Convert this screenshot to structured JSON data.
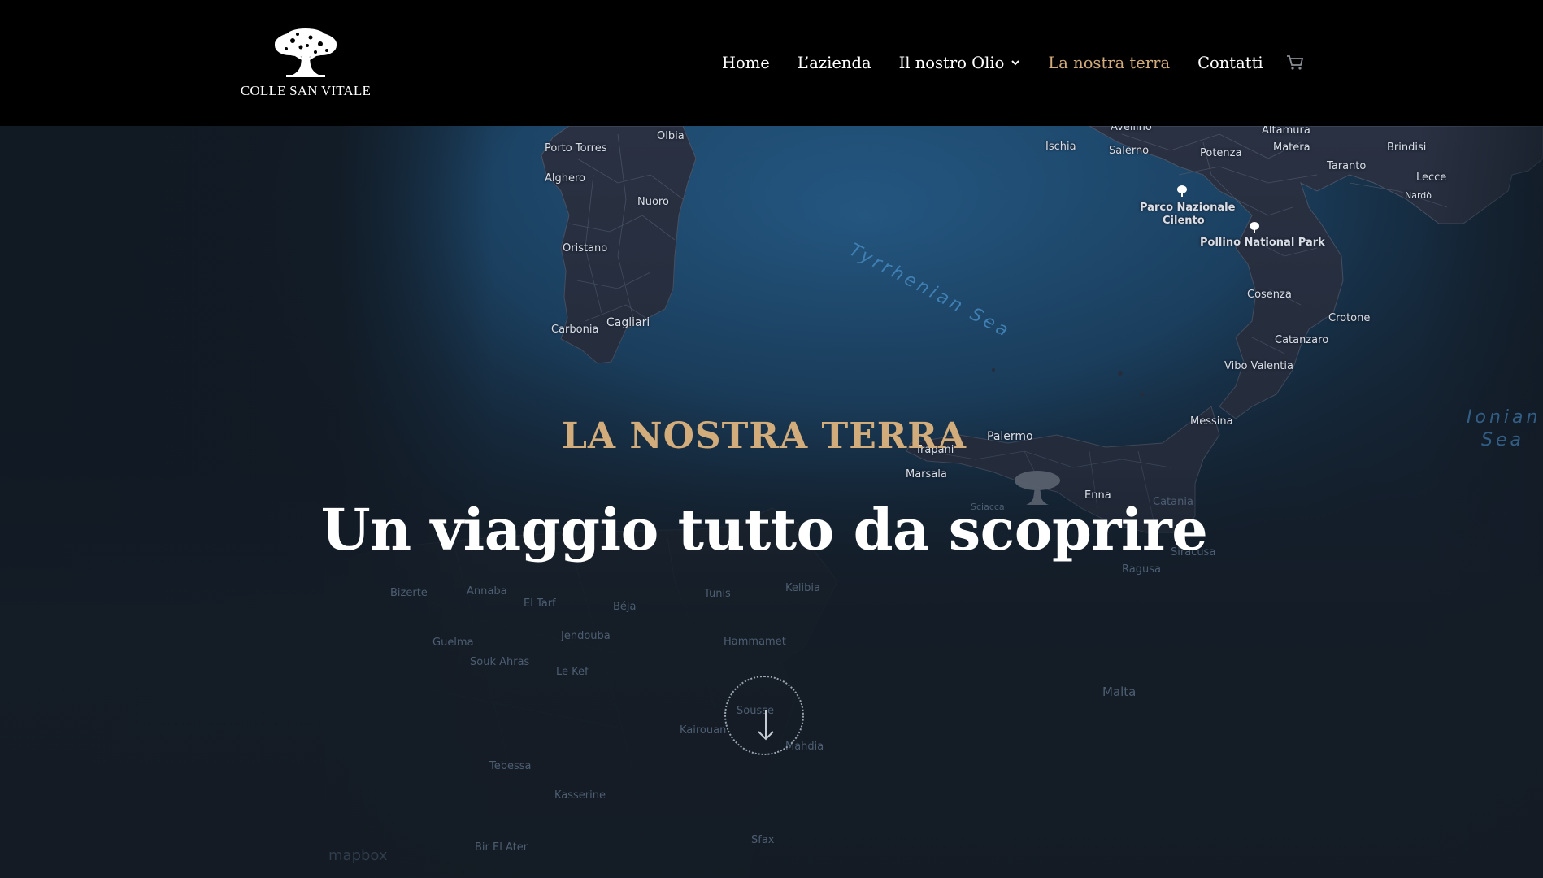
{
  "header": {
    "brand": "COLLE SAN VITALE",
    "logo_icon": "olive-tree-icon",
    "nav": [
      {
        "label": "Home",
        "active": false
      },
      {
        "label": "L’azienda",
        "active": false
      },
      {
        "label": "Il nostro Olio",
        "active": false,
        "has_dropdown": true
      },
      {
        "label": "La nostra terra",
        "active": true
      },
      {
        "label": "Contatti",
        "active": false
      }
    ],
    "cart_icon": "shopping-cart-icon",
    "active_color": "#d2ac7a"
  },
  "hero": {
    "eyebrow": "LA NOSTRA TERRA",
    "title": "Un viaggio tutto da scoprire",
    "scroll_icon": "arrow-down-icon",
    "attribution": "mapbox"
  },
  "map": {
    "seas": [
      "Tyrrhenian Sea",
      "Ionian",
      "Sea"
    ],
    "places": [
      "Olbia",
      "Porto Torres",
      "Alghero",
      "Nuoro",
      "Oristano",
      "Carbonia",
      "Cagliari",
      "Avellino",
      "Altamura",
      "Ischia",
      "Salerno",
      "Potenza",
      "Matera",
      "Brindisi",
      "Taranto",
      "Lecce",
      "Nardò",
      "Parco Nazionale",
      "Cilento",
      "Pollino National Park",
      "Cosenza",
      "Crotone",
      "Catanzaro",
      "Vibo Valentia",
      "Messina",
      "Palermo",
      "Trapani",
      "Marsala",
      "Sciacca",
      "Enna",
      "Catania",
      "Siracusa",
      "Ragusa",
      "Malta",
      "Bizerte",
      "Annaba",
      "El Tarf",
      "Béja",
      "Tunis",
      "Kelibia",
      "Guelma",
      "Souk Ahras",
      "Jendouba",
      "Le Kef",
      "Hammamet",
      "Sousse",
      "Kairouan",
      "Mahdia",
      "Tebessa",
      "Kasserine",
      "Bir El Ater",
      "Sfax",
      "Souk Ahras"
    ]
  }
}
